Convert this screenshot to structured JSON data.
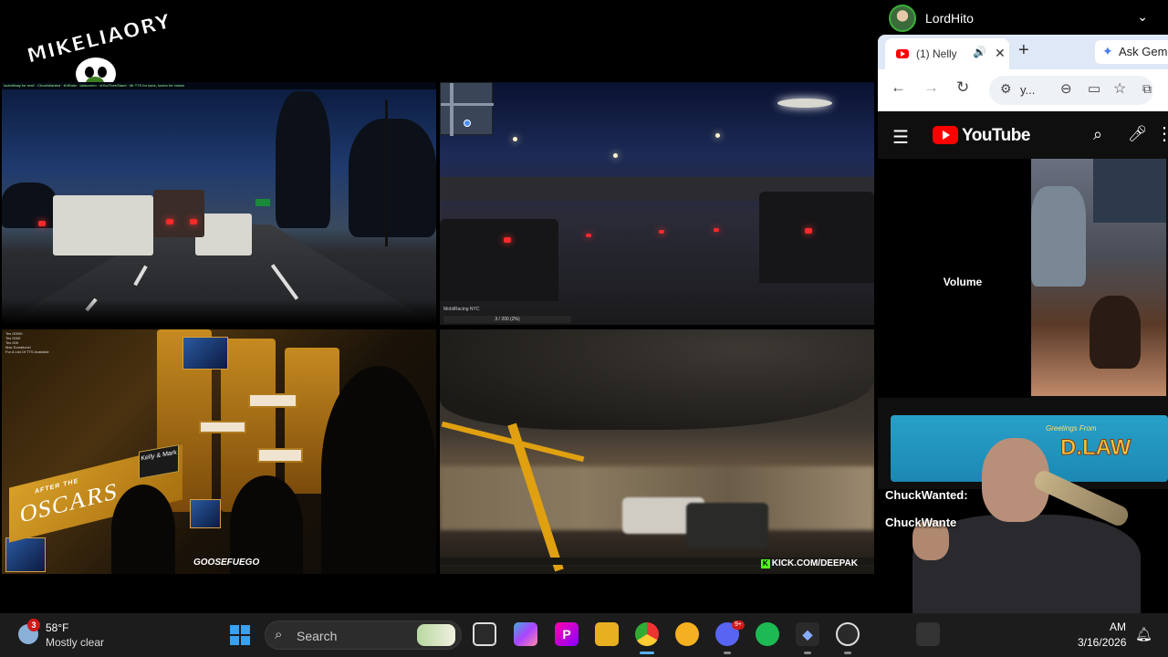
{
  "overlay": {
    "logo_text": "MIKELIAORY",
    "chat_strip_top": "lochaNnay for real! · ChuckWanted · KhRatio · blakoverlo · wYouTheeStand · Mr TTS for subs, lockxx for voices",
    "highway_caption": "",
    "bridge_caption": "MobilRacing NYC",
    "bridge_progress": "3 / 200 (2%)",
    "oscars_list": [
      "Tes 0000K",
      "Tes 000K",
      "Tes 00K",
      "Max Donations!",
      "For A List Of TTS Available"
    ],
    "oscars_sign_line1": "AFTER THE",
    "oscars_sign_line2": "OSCARS",
    "oscars_kelly": "Kelly & Mark",
    "goose_tag": "GOOSEFUEGO",
    "kick_tag": "KICK.COM/DEEPAK",
    "kick_letter": "K"
  },
  "profile": {
    "name": "LordHito",
    "chevron": "⌄"
  },
  "browser": {
    "tab_title": "(1) Nelly",
    "tab_audio_icon": "🔊",
    "tab_close": "✕",
    "new_tab": "+",
    "gemini_label": "Ask Gem",
    "omnibox_text": "y...",
    "back": "←",
    "forward": "→",
    "reload": "↻"
  },
  "youtube": {
    "wordmark": "YouTube",
    "volume_label": "Volume"
  },
  "banner": {
    "greeting": "Greetings From",
    "title": "D.LAW"
  },
  "chat": [
    {
      "user": "ChuckWanted:"
    },
    {
      "user": "ChuckWante"
    }
  ],
  "taskbar": {
    "weather_badge": "3",
    "weather_temp": "58°F",
    "weather_desc": "Mostly clear",
    "search_label": "Search",
    "discord_badge": "9+",
    "clock_time": "AM",
    "clock_date": "3/16/2026"
  },
  "colors": {
    "youtube_red": "#ff0000",
    "taskbar_bg": "#1c1c1c",
    "windows_blue": "#3aa0f0",
    "kick_green": "#53fc18"
  }
}
